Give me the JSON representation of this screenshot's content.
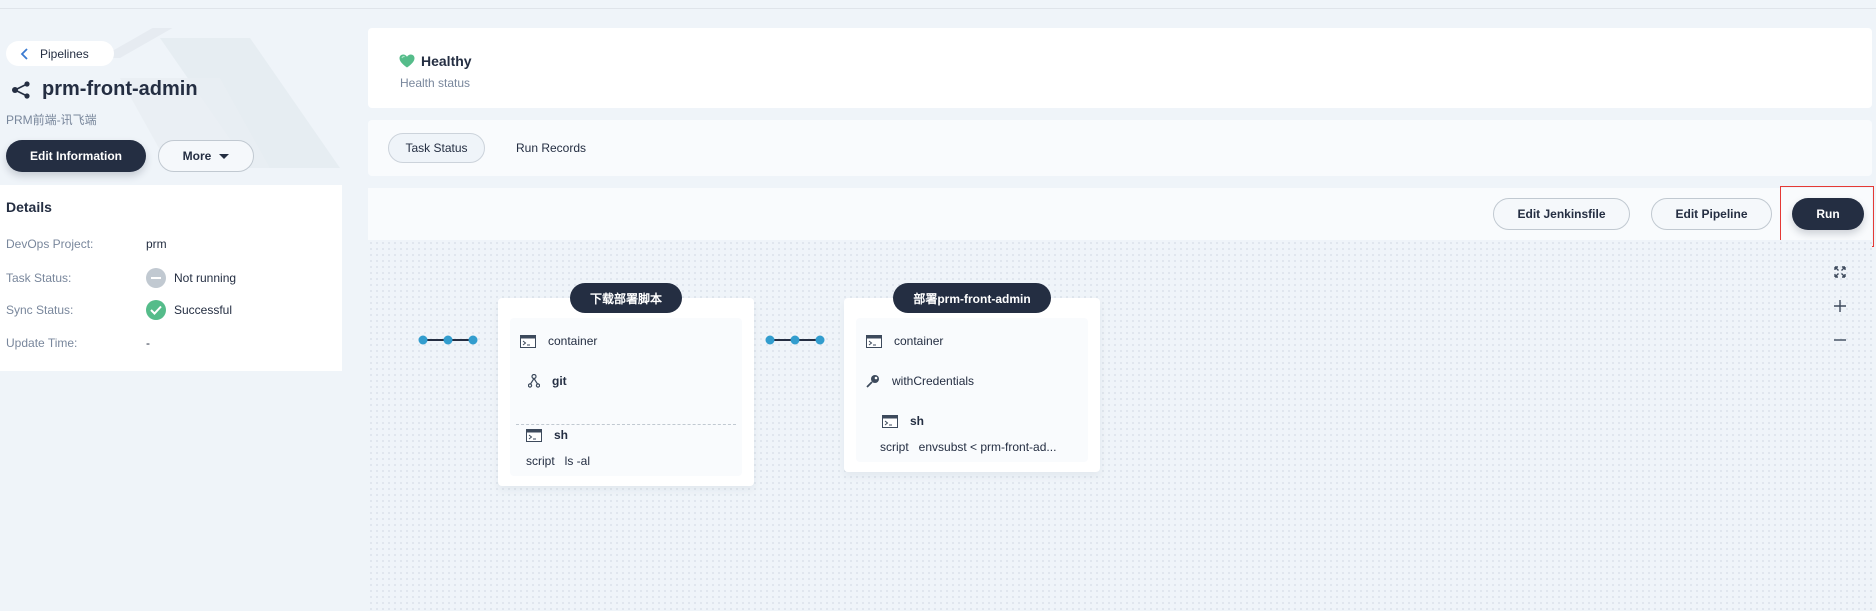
{
  "header": {
    "back_label": "Pipelines",
    "pipeline_name": "prm-front-admin",
    "description": "PRM前端-讯飞端",
    "edit_info_label": "Edit Information",
    "more_label": "More"
  },
  "details": {
    "title": "Details",
    "rows": [
      {
        "key": "DevOps Project:",
        "value": "prm"
      },
      {
        "key": "Task Status:",
        "value": "Not running"
      },
      {
        "key": "Sync Status:",
        "value": "Successful"
      },
      {
        "key": "Update Time:",
        "value": "-"
      }
    ]
  },
  "health": {
    "status": "Healthy",
    "label": "Health status"
  },
  "tabs": [
    {
      "label": "Task Status",
      "active": true
    },
    {
      "label": "Run Records",
      "active": false
    }
  ],
  "toolbar": {
    "edit_jenkinsfile_label": "Edit Jenkinsfile",
    "edit_pipeline_label": "Edit Pipeline",
    "run_label": "Run"
  },
  "stages": [
    {
      "name": "下载部署脚本",
      "steps": [
        {
          "icon": "terminal-icon",
          "label": "container"
        },
        {
          "icon": "git-branch-icon",
          "label": "git"
        },
        {
          "icon": "terminal-icon",
          "label": "sh",
          "param_key": "script",
          "param_value": "ls -al"
        }
      ]
    },
    {
      "name": "部署prm-front-admin",
      "steps": [
        {
          "icon": "terminal-icon",
          "label": "container"
        },
        {
          "icon": "key-icon",
          "label": "withCredentials"
        },
        {
          "icon": "terminal-icon",
          "label": "sh",
          "param_key": "script",
          "param_value": "envsubst < prm-front-ad..."
        }
      ]
    }
  ],
  "colors": {
    "primary_dark": "#242e42",
    "success": "#55bc8a",
    "healthy": "#55bc8a",
    "connector": "#329dce",
    "highlight_border": "#e53935"
  }
}
